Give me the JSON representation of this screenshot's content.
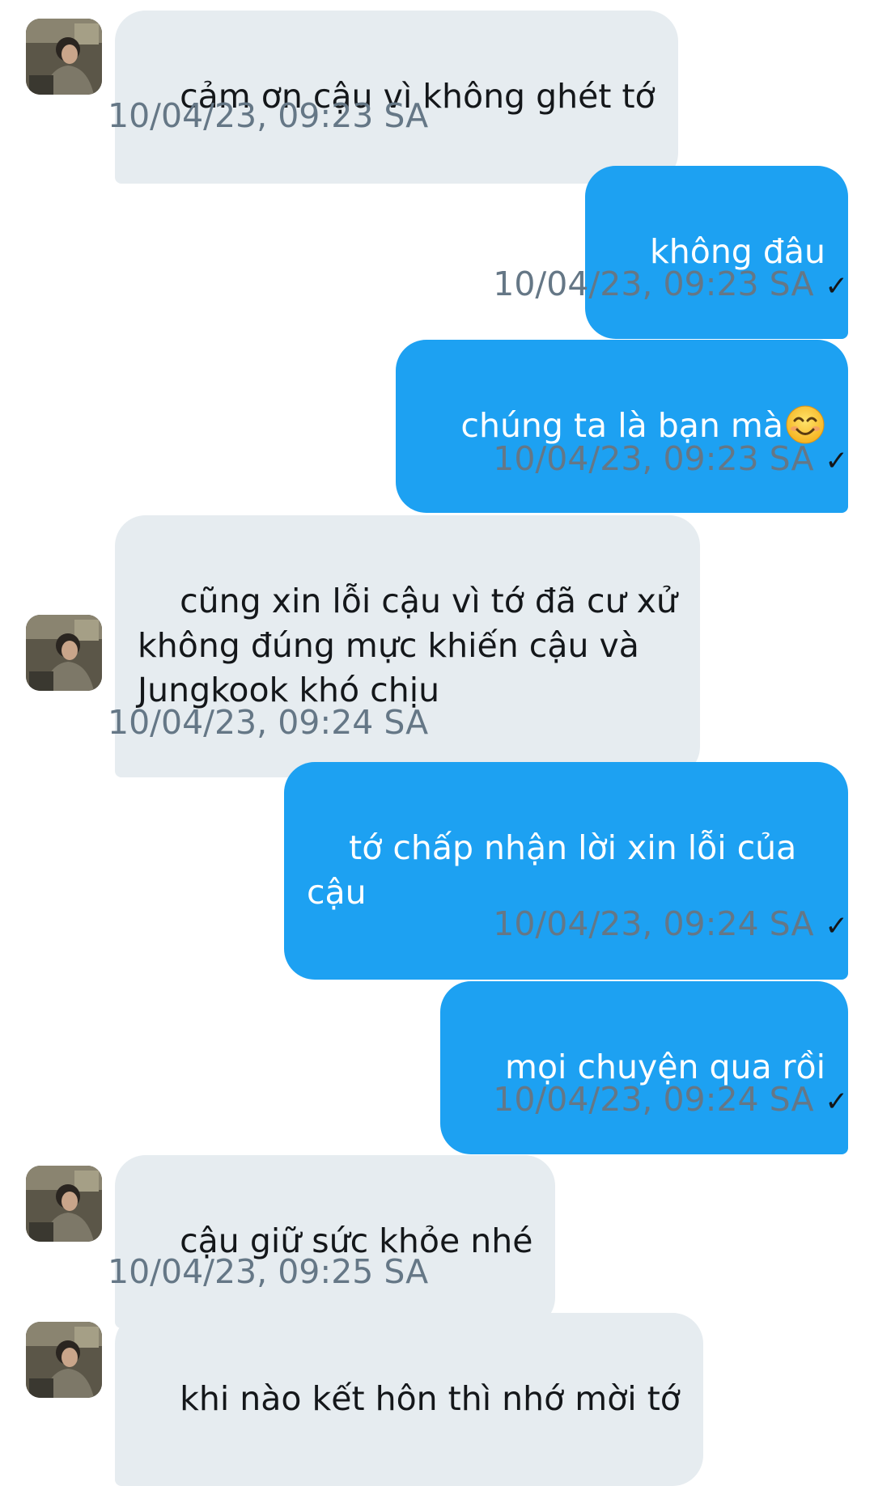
{
  "conversation": {
    "messages": [
      {
        "direction": "incoming",
        "text": "cảm ơn cậu vì không ghét tớ",
        "timestamp": "10/04/23, 09:23 SA"
      },
      {
        "direction": "outgoing",
        "text": "không đâu",
        "timestamp": "10/04/23, 09:23 SA",
        "status": "✓"
      },
      {
        "direction": "outgoing",
        "text": "chúng ta là bạn mà",
        "emoji": "smiling-face-with-smiling-eyes",
        "timestamp": "10/04/23, 09:23 SA",
        "status": "✓"
      },
      {
        "direction": "incoming",
        "text": "cũng xin lỗi cậu vì tớ đã cư xử\nkhông đúng mực khiến cậu và\nJungkook khó chịu",
        "timestamp": "10/04/23, 09:24 SA"
      },
      {
        "direction": "outgoing",
        "text": "tớ chấp nhận lời xin lỗi của\ncậu",
        "timestamp": "10/04/23, 09:24 SA",
        "status": "✓"
      },
      {
        "direction": "outgoing",
        "text": "mọi chuyện qua rồi",
        "timestamp": "10/04/23, 09:24 SA",
        "status": "✓"
      },
      {
        "direction": "incoming",
        "text": "cậu giữ sức khỏe nhé",
        "timestamp": "10/04/23, 09:25 SA"
      },
      {
        "direction": "incoming",
        "text": "khi nào kết hôn thì nhớ mời tớ"
      }
    ]
  },
  "colors": {
    "incoming_bubble": "#e6ecf0",
    "outgoing_bubble": "#1da1f2",
    "timestamp_text": "#657786"
  }
}
